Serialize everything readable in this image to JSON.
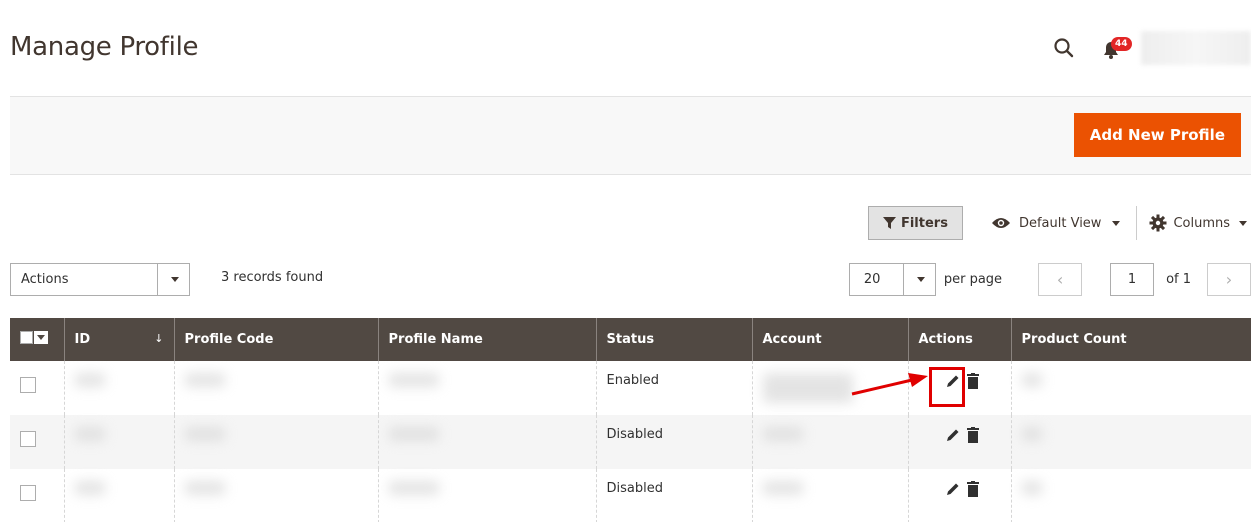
{
  "page": {
    "title": "Manage Profile"
  },
  "header": {
    "notifications_count": "44"
  },
  "action_bar": {
    "add_button_label": "Add New Profile"
  },
  "toolbar": {
    "filters_label": "Filters",
    "view_label": "Default View",
    "columns_label": "Columns",
    "actions_label": "Actions",
    "records_text": "3 records found",
    "per_page_value": "20",
    "per_page_label": "per page",
    "page_current": "1",
    "page_total": "of 1"
  },
  "grid": {
    "columns": [
      "ID",
      "Profile Code",
      "Profile Name",
      "Status",
      "Account",
      "Actions",
      "Product Count"
    ],
    "sort_indicator": "↓",
    "rows": [
      {
        "status": "Enabled"
      },
      {
        "status": "Disabled"
      },
      {
        "status": "Disabled"
      }
    ]
  },
  "colors": {
    "accent": "#eb5202",
    "header_bg": "#514943",
    "badge": "#e22626",
    "annotation": "#e00000"
  },
  "icons": [
    "search-icon",
    "bell-icon",
    "filter-icon",
    "eye-icon",
    "gear-icon",
    "pencil-icon",
    "trash-icon"
  ]
}
